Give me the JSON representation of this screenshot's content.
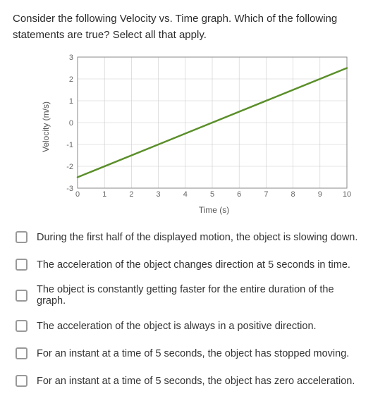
{
  "prompt": "Consider the following Velocity vs. Time graph. Which of the following statements are true?  Select all that apply.",
  "chart_data": {
    "type": "line",
    "title": "",
    "xlabel": "Time (s)",
    "ylabel": "Velocity (m/s)",
    "xlim": [
      0,
      10
    ],
    "ylim": [
      -3,
      3
    ],
    "xticks": [
      0,
      1,
      2,
      3,
      4,
      5,
      6,
      7,
      8,
      9,
      10
    ],
    "yticks": [
      -3,
      -2,
      -1,
      0,
      1,
      2,
      3
    ],
    "series": [
      {
        "name": "velocity",
        "x": [
          0,
          10
        ],
        "y": [
          -2.5,
          2.5
        ],
        "color": "#5a8f29"
      }
    ]
  },
  "options": [
    {
      "label": "During the first half of the displayed motion, the object is slowing down."
    },
    {
      "label": "The acceleration of the object changes direction at 5 seconds in time."
    },
    {
      "label": "The object is constantly getting faster for the entire duration of the graph."
    },
    {
      "label": "The acceleration of the object is always in a positive direction."
    },
    {
      "label": "For an instant at a time of 5 seconds, the object has stopped moving."
    },
    {
      "label": "For an instant at a time of 5 seconds, the object has zero acceleration."
    }
  ]
}
